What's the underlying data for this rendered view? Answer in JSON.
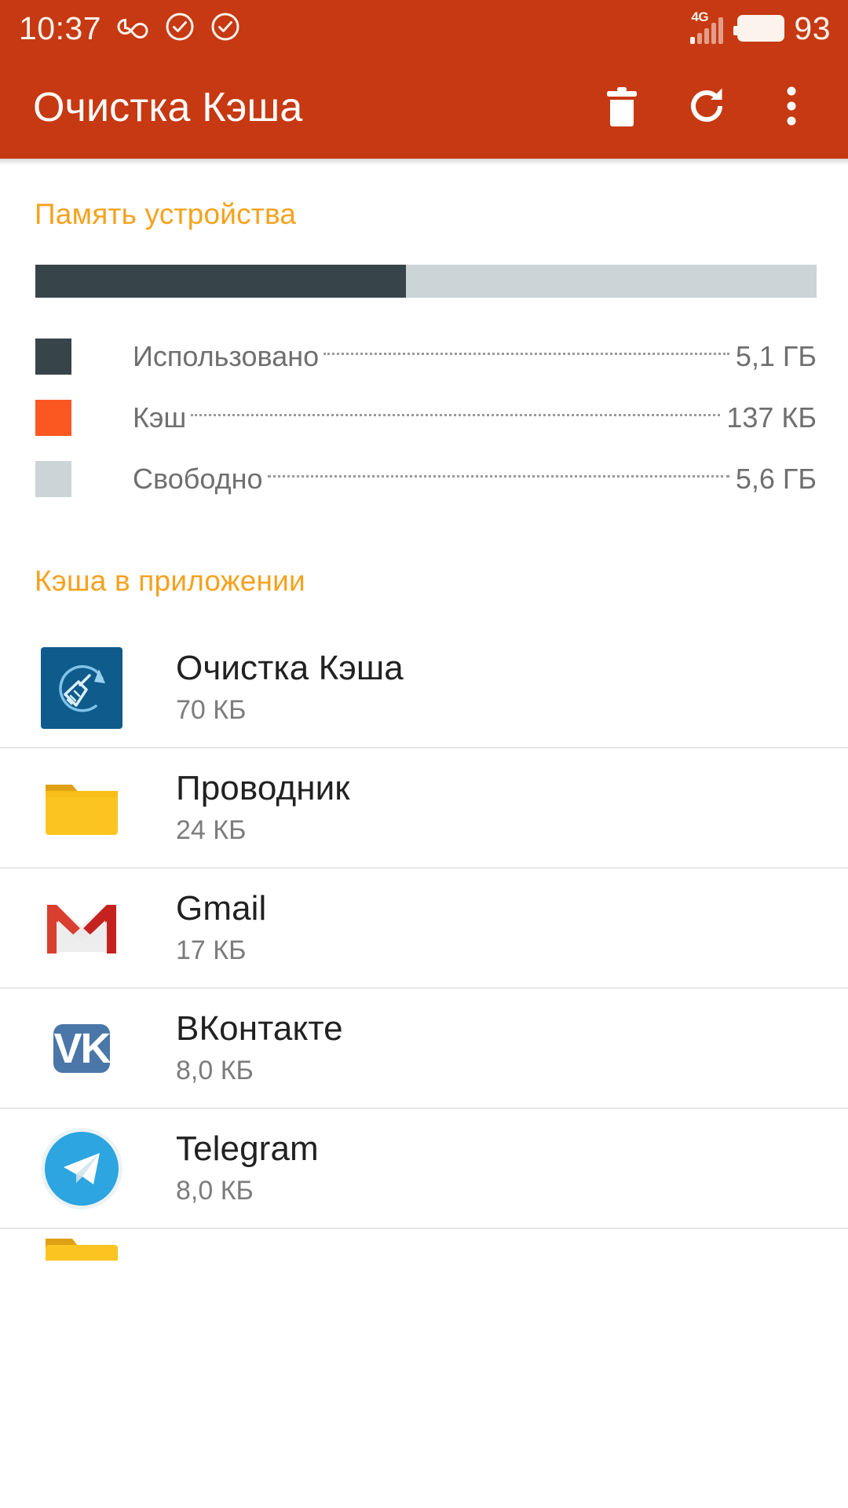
{
  "statusbar": {
    "time": "10:37",
    "icons": [
      "infinity-icon",
      "check-circle-icon",
      "check-circle-icon"
    ],
    "network_type": "4G",
    "battery_level": "93"
  },
  "appbar": {
    "title": "Очистка Кэша",
    "actions": [
      {
        "name": "delete-icon",
        "label": "delete"
      },
      {
        "name": "refresh-icon",
        "label": "refresh"
      },
      {
        "name": "overflow-menu-icon",
        "label": "more"
      }
    ]
  },
  "storage": {
    "section_title": "Память устройства",
    "bar": {
      "used_pct": 47.4,
      "cache_pct": 0.0,
      "free_pct": 52.6
    },
    "legend": [
      {
        "label": "Использовано",
        "value": "5,1 ГБ",
        "color": "#37444A"
      },
      {
        "label": "Кэш",
        "value": "137 КБ",
        "color": "#FB5721"
      },
      {
        "label": "Свободно",
        "value": "5,6 ГБ",
        "color": "#CBD5D7"
      }
    ]
  },
  "apps": {
    "section_title": "Кэша в приложении",
    "items": [
      {
        "name": "Очистка Кэша",
        "size": "70 КБ",
        "icon": "cache-cleaner-icon"
      },
      {
        "name": "Проводник",
        "size": "24 КБ",
        "icon": "folder-icon"
      },
      {
        "name": "Gmail",
        "size": "17 КБ",
        "icon": "gmail-icon"
      },
      {
        "name": "ВКонтакте",
        "size": "8,0 КБ",
        "icon": "vk-icon"
      },
      {
        "name": "Telegram",
        "size": "8,0 КБ",
        "icon": "telegram-icon"
      }
    ]
  },
  "colors": {
    "brand": "#C63912",
    "accent": "#F5A21E",
    "used": "#37444A",
    "cache": "#FB5721",
    "free": "#CBD5D7"
  }
}
